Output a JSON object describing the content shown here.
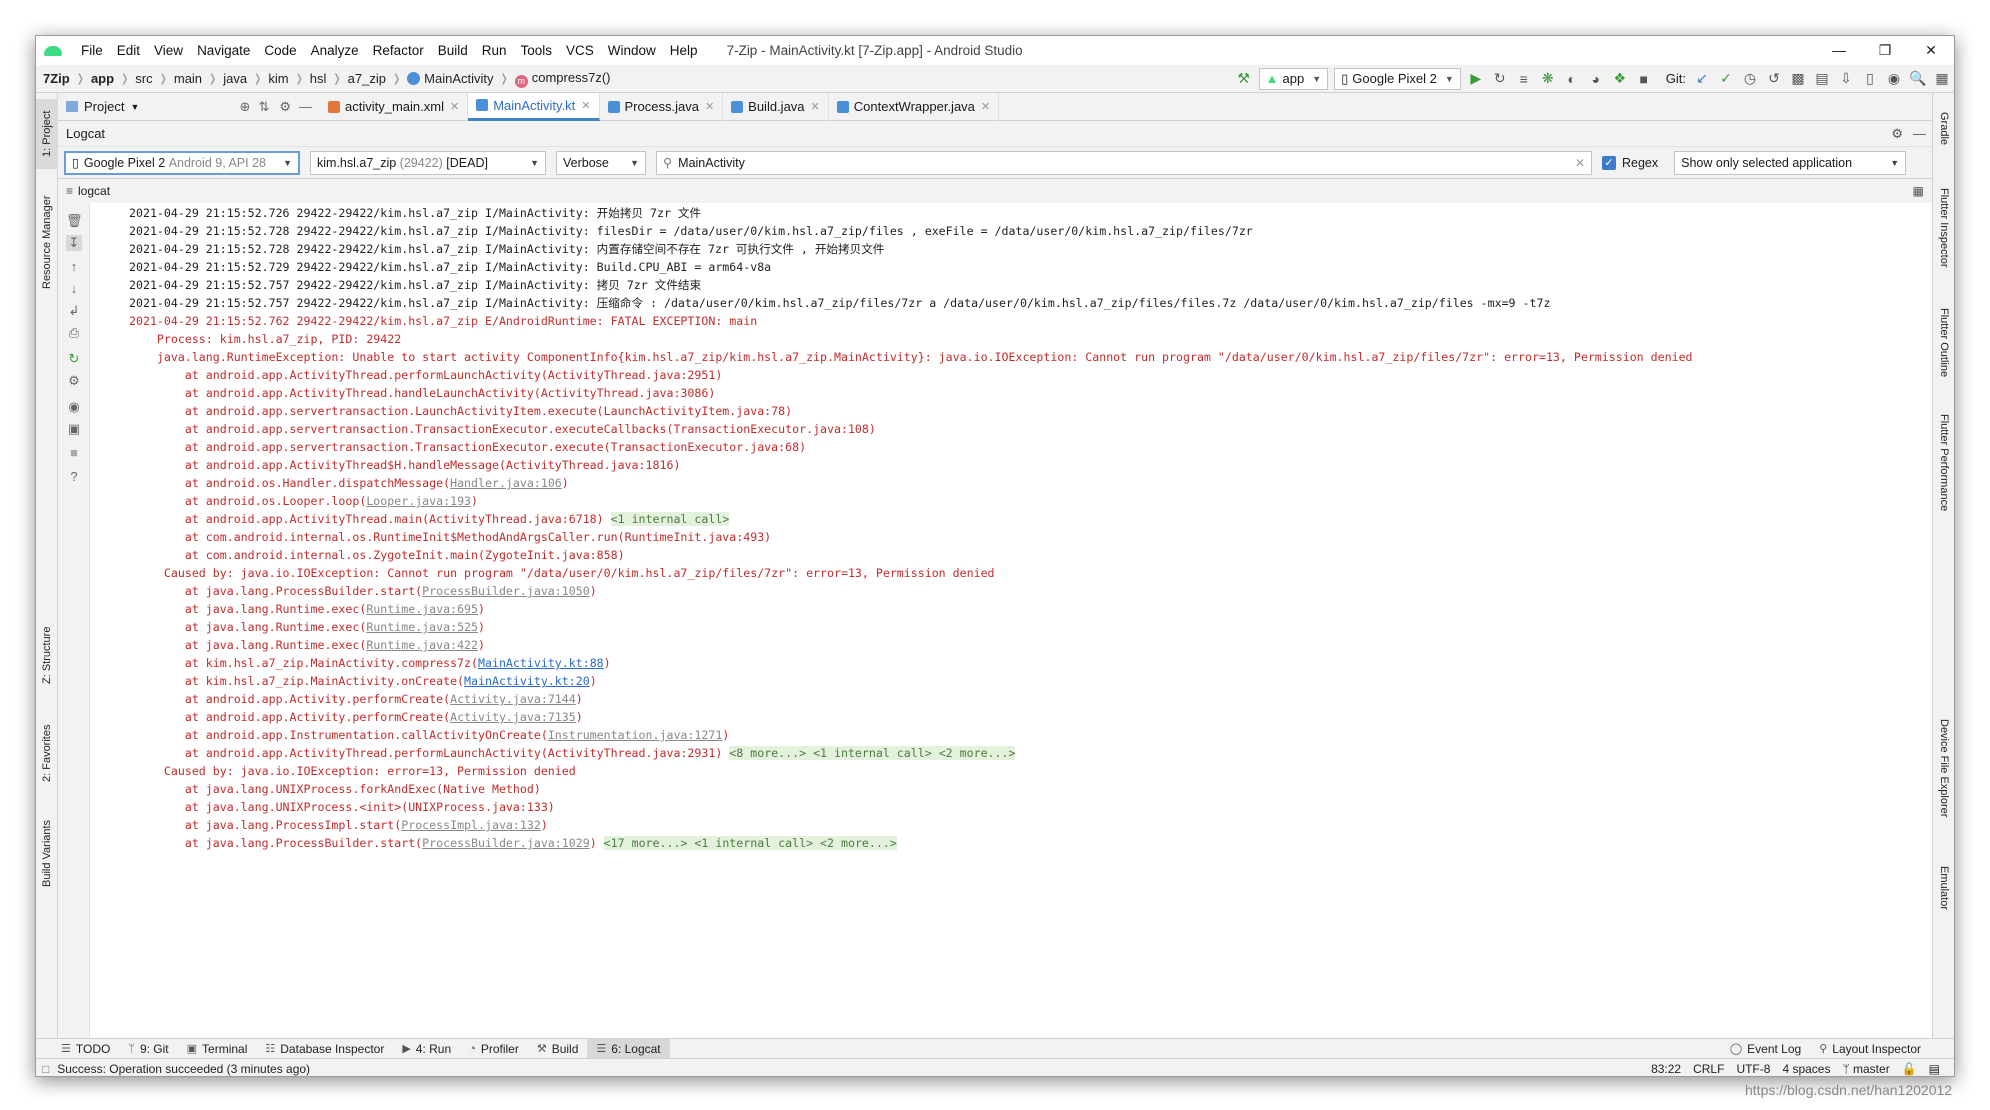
{
  "menubar": {
    "items": [
      "File",
      "Edit",
      "View",
      "Navigate",
      "Code",
      "Analyze",
      "Refactor",
      "Build",
      "Run",
      "Tools",
      "VCS",
      "Window",
      "Help"
    ],
    "window_title": "7-Zip - MainActivity.kt [7-Zip.app] - Android Studio"
  },
  "navbar": {
    "breadcrumbs": [
      "7Zip",
      "app",
      "src",
      "main",
      "java",
      "kim",
      "hsl",
      "a7_zip",
      "MainActivity",
      "compress7z()"
    ],
    "run_config": "app",
    "device": "Google Pixel 2",
    "git_label": "Git:"
  },
  "left_tool_windows": [
    "1: Project",
    "Resource Manager",
    "Z: Structure",
    "2: Favorites",
    "Build Variants"
  ],
  "right_tool_windows": [
    "Gradle",
    "Flutter Inspector",
    "Flutter Outline",
    "Flutter Performance",
    "Device File Explorer",
    "Emulator"
  ],
  "project_panel": {
    "label": "Project"
  },
  "editor_tabs": [
    {
      "label": "activity_main.xml",
      "active": false,
      "color": "#e1773d"
    },
    {
      "label": "MainActivity.kt",
      "active": true,
      "color": "#4a8fd8"
    },
    {
      "label": "Process.java",
      "active": false,
      "color": "#4a8fd8"
    },
    {
      "label": "Build.java",
      "active": false,
      "color": "#4a8fd8"
    },
    {
      "label": "ContextWrapper.java",
      "active": false,
      "color": "#4a8fd8"
    }
  ],
  "logcat": {
    "title": "Logcat",
    "device_name": "Google Pixel 2",
    "device_detail": "Android 9, API 28",
    "process_name": "kim.hsl.a7_zip",
    "process_pid": "(29422)",
    "process_state": "[DEAD]",
    "level": "Verbose",
    "search_value": "MainActivity",
    "regex_label": "Regex",
    "filter_mode": "Show only selected application",
    "sub_tab": "logcat"
  },
  "log_lines": [
    {
      "t": "i",
      "parts": [
        {
          "s": "2021-04-29 21:15:52.726 29422-29422/kim.hsl.a7_zip I/MainActivity: 开始拷贝 7zr 文件"
        }
      ]
    },
    {
      "t": "i",
      "parts": [
        {
          "s": "2021-04-29 21:15:52.728 29422-29422/kim.hsl.a7_zip I/MainActivity: filesDir = /data/user/0/kim.hsl.a7_zip/files , exeFile = /data/user/0/kim.hsl.a7_zip/files/7zr"
        }
      ]
    },
    {
      "t": "i",
      "parts": [
        {
          "s": "2021-04-29 21:15:52.728 29422-29422/kim.hsl.a7_zip I/MainActivity: 内置存储空间不存在 7zr 可执行文件 , 开始拷贝文件"
        }
      ]
    },
    {
      "t": "i",
      "parts": [
        {
          "s": "2021-04-29 21:15:52.729 29422-29422/kim.hsl.a7_zip I/MainActivity: Build.CPU_ABI = arm64-v8a"
        }
      ]
    },
    {
      "t": "i",
      "parts": [
        {
          "s": "2021-04-29 21:15:52.757 29422-29422/kim.hsl.a7_zip I/MainActivity: 拷贝 7zr 文件结束"
        }
      ]
    },
    {
      "t": "i",
      "parts": [
        {
          "s": "2021-04-29 21:15:52.757 29422-29422/kim.hsl.a7_zip I/MainActivity: 压缩命令 : /data/user/0/kim.hsl.a7_zip/files/7zr a /data/user/0/kim.hsl.a7_zip/files/files.7z /data/user/0/kim.hsl.a7_zip/files -mx=9 -t7z"
        }
      ]
    },
    {
      "t": "e",
      "parts": [
        {
          "s": "2021-04-29 21:15:52.762 29422-29422/kim.hsl.a7_zip E/AndroidRuntime: FATAL EXCEPTION: main"
        }
      ]
    },
    {
      "t": "e",
      "parts": [
        {
          "s": "    Process: kim.hsl.a7_zip, PID: 29422"
        }
      ]
    },
    {
      "t": "e",
      "parts": [
        {
          "s": "    java.lang.RuntimeException: Unable to start activity ComponentInfo{kim.hsl.a7_zip/kim.hsl.a7_zip.MainActivity}: java.io.IOException: Cannot run program \"/data/user/0/kim.hsl.a7_zip/files/7zr\": error=13, Permission denied"
        }
      ]
    },
    {
      "t": "e",
      "parts": [
        {
          "s": "        at android.app.ActivityThread.performLaunchActivity(ActivityThread.java:2951)"
        }
      ]
    },
    {
      "t": "e",
      "parts": [
        {
          "s": "        at android.app.ActivityThread.handleLaunchActivity(ActivityThread.java:3086)"
        }
      ]
    },
    {
      "t": "e",
      "parts": [
        {
          "s": "        at android.app.servertransaction.LaunchActivityItem.execute(LaunchActivityItem.java:78)"
        }
      ]
    },
    {
      "t": "e",
      "parts": [
        {
          "s": "        at android.app.servertransaction.TransactionExecutor.executeCallbacks(TransactionExecutor.java:108)"
        }
      ]
    },
    {
      "t": "e",
      "parts": [
        {
          "s": "        at android.app.servertransaction.TransactionExecutor.execute(TransactionExecutor.java:68)"
        }
      ]
    },
    {
      "t": "e",
      "parts": [
        {
          "s": "        at android.app.ActivityThread$H.handleMessage(ActivityThread.java:1816)"
        }
      ]
    },
    {
      "t": "e",
      "parts": [
        {
          "s": "        at android.os.Handler.dispatchMessage("
        },
        {
          "s": "Handler.java:106",
          "c": "lnk"
        },
        {
          "s": ")"
        }
      ]
    },
    {
      "t": "e",
      "parts": [
        {
          "s": "        at android.os.Looper.loop("
        },
        {
          "s": "Looper.java:193",
          "c": "lnk"
        },
        {
          "s": ")"
        }
      ]
    },
    {
      "t": "e",
      "parts": [
        {
          "s": "        at android.app.ActivityThread.main(ActivityThread.java:6718) "
        },
        {
          "s": "<1 internal call>",
          "c": "fold"
        }
      ]
    },
    {
      "t": "e",
      "parts": [
        {
          "s": "        at com.android.internal.os.RuntimeInit$MethodAndArgsCaller.run(RuntimeInit.java:493)"
        }
      ]
    },
    {
      "t": "e",
      "parts": [
        {
          "s": "        at com.android.internal.os.ZygoteInit.main(ZygoteInit.java:858)"
        }
      ]
    },
    {
      "t": "e",
      "parts": [
        {
          "s": "     Caused by: java.io.IOException: Cannot run program \"/data/user/0/kim.hsl.a7_zip/files/7zr\": error=13, Permission denied"
        }
      ]
    },
    {
      "t": "e",
      "parts": [
        {
          "s": "        at java.lang.ProcessBuilder.start("
        },
        {
          "s": "ProcessBuilder.java:1050",
          "c": "lnk"
        },
        {
          "s": ")"
        }
      ]
    },
    {
      "t": "e",
      "parts": [
        {
          "s": "        at java.lang.Runtime.exec("
        },
        {
          "s": "Runtime.java:695",
          "c": "lnk"
        },
        {
          "s": ")"
        }
      ]
    },
    {
      "t": "e",
      "parts": [
        {
          "s": "        at java.lang.Runtime.exec("
        },
        {
          "s": "Runtime.java:525",
          "c": "lnk"
        },
        {
          "s": ")"
        }
      ]
    },
    {
      "t": "e",
      "parts": [
        {
          "s": "        at java.lang.Runtime.exec("
        },
        {
          "s": "Runtime.java:422",
          "c": "lnk"
        },
        {
          "s": ")"
        }
      ]
    },
    {
      "t": "e",
      "parts": [
        {
          "s": "        at kim.hsl.a7_zip.MainActivity.compress7z("
        },
        {
          "s": "MainActivity.kt:88",
          "c": "blue"
        },
        {
          "s": ")"
        }
      ]
    },
    {
      "t": "e",
      "parts": [
        {
          "s": "        at kim.hsl.a7_zip.MainActivity.onCreate("
        },
        {
          "s": "MainActivity.kt:20",
          "c": "blue"
        },
        {
          "s": ")"
        }
      ]
    },
    {
      "t": "e",
      "parts": [
        {
          "s": "        at android.app.Activity.performCreate("
        },
        {
          "s": "Activity.java:7144",
          "c": "lnk"
        },
        {
          "s": ")"
        }
      ]
    },
    {
      "t": "e",
      "parts": [
        {
          "s": "        at android.app.Activity.performCreate("
        },
        {
          "s": "Activity.java:7135",
          "c": "lnk"
        },
        {
          "s": ")"
        }
      ]
    },
    {
      "t": "e",
      "parts": [
        {
          "s": "        at android.app.Instrumentation.callActivityOnCreate("
        },
        {
          "s": "Instrumentation.java:1271",
          "c": "lnk"
        },
        {
          "s": ")"
        }
      ]
    },
    {
      "t": "e",
      "parts": [
        {
          "s": "        at android.app.ActivityThread.performLaunchActivity(ActivityThread.java:2931) "
        },
        {
          "s": "<8 more...> <1 internal call> <2 more...>",
          "c": "fold"
        }
      ]
    },
    {
      "t": "e",
      "parts": [
        {
          "s": "     Caused by: java.io.IOException: error=13, Permission denied"
        }
      ]
    },
    {
      "t": "e",
      "parts": [
        {
          "s": "        at java.lang.UNIXProcess.forkAndExec(Native Method)"
        }
      ]
    },
    {
      "t": "e",
      "parts": [
        {
          "s": "        at java.lang.UNIXProcess.<init>(UNIXProcess.java:133)"
        }
      ]
    },
    {
      "t": "e",
      "parts": [
        {
          "s": "        at java.lang.ProcessImpl.start("
        },
        {
          "s": "ProcessImpl.java:132",
          "c": "lnk"
        },
        {
          "s": ")"
        }
      ]
    },
    {
      "t": "e",
      "parts": [
        {
          "s": "        at java.lang.ProcessBuilder.start("
        },
        {
          "s": "ProcessBuilder.java:1029",
          "c": "lnk"
        },
        {
          "s": ") "
        },
        {
          "s": "<17 more...> <1 internal call> <2 more...>",
          "c": "fold"
        }
      ]
    }
  ],
  "bottom_tabs": [
    {
      "label": "TODO",
      "icon": "☰",
      "active": false
    },
    {
      "label": "9: Git",
      "icon": "ᛘ",
      "active": false
    },
    {
      "label": "Terminal",
      "icon": "▣",
      "active": false
    },
    {
      "label": "Database Inspector",
      "icon": "☷",
      "active": false
    },
    {
      "label": "4: Run",
      "icon": "▶",
      "active": false
    },
    {
      "label": "Profiler",
      "icon": "◔",
      "active": false
    },
    {
      "label": "Build",
      "icon": "⚒",
      "active": false
    },
    {
      "label": "6: Logcat",
      "icon": "☰",
      "active": true
    }
  ],
  "bottom_right_tabs": [
    "Event Log",
    "Layout Inspector"
  ],
  "status": {
    "message": "Success: Operation succeeded (3 minutes ago)",
    "position": "83:22",
    "line_sep": "CRLF",
    "encoding": "UTF-8",
    "indent": "4 spaces",
    "branch": "master"
  },
  "watermark": "https://blog.csdn.net/han1202012"
}
